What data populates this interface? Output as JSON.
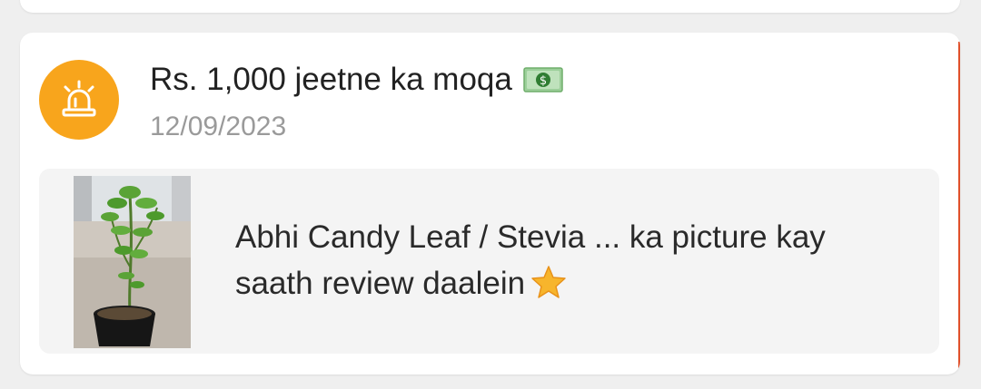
{
  "notification": {
    "title": "Rs. 1,000 jeetne ka moqa",
    "date": "12/09/2023",
    "message": "Abhi Candy Leaf / Stevia ... ka picture kay saath review daalein",
    "icon": "alert-siren-icon",
    "title_emoji": "money-bill-icon",
    "message_emoji": "star-icon"
  },
  "colors": {
    "accent": "#f8a51c",
    "border_accent": "#e0502a",
    "star": "#f7b52c"
  }
}
